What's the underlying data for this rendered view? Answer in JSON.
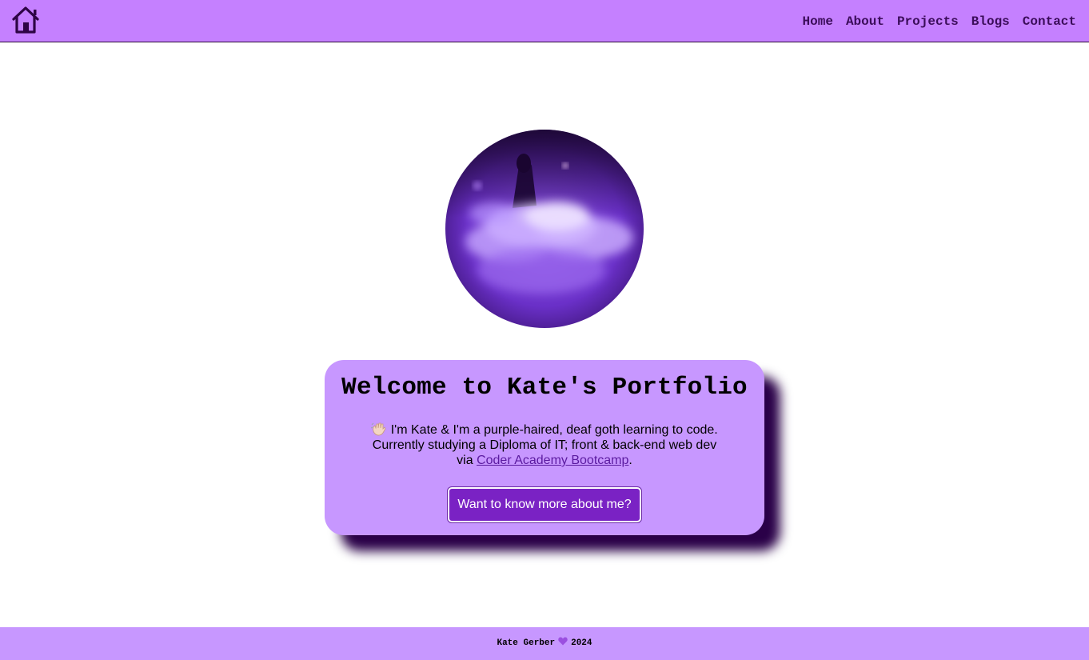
{
  "nav": {
    "home_icon": "house-icon",
    "links": [
      {
        "label": "Home"
      },
      {
        "label": "About"
      },
      {
        "label": "Projects"
      },
      {
        "label": "Blogs"
      },
      {
        "label": "Contact"
      }
    ]
  },
  "hero": {
    "image": "purple-fog-portrait"
  },
  "card": {
    "title": "Welcome to Kate's Portfolio",
    "wave_icon": "waving-hand-icon",
    "intro": "I'm Kate & I'm a purple-haired, deaf goth learning to code.",
    "line2": "Currently studying a Diploma of IT; front & back-end web dev",
    "via": "via",
    "link_text": "Coder Academy Bootcamp",
    "period": ".",
    "cta_label": "Want to know more about me?"
  },
  "footer": {
    "name": "Kate Gerber",
    "heart_icon": "purple-heart-icon",
    "year": "2024"
  },
  "colors": {
    "nav_bg": "#c580ff",
    "card_bg": "#c797ff",
    "button_bg": "#7a22c4",
    "shadow": "#2a0048"
  }
}
